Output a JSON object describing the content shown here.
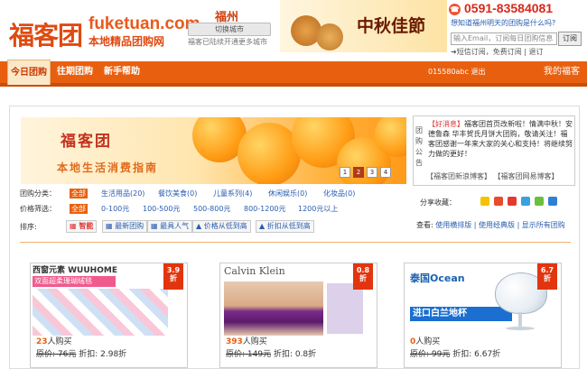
{
  "header": {
    "logo_cn": "福客团",
    "logo_en": "fuketuan.com",
    "logo_tag": "本地精品团购网",
    "city": "福州",
    "switch_city": "切换城市",
    "opened_cities": "福客已陆续开通更多城市",
    "mooncake_banner": "中秋佳節",
    "phone": "0591-83584081",
    "question": "想知道福州明天的团购是什么吗?",
    "email_placeholder": "输入Email，订阅每日团购信息",
    "subscribe": "订阅",
    "subscribe_links": "➜短信订阅，免费订阅 | 退订"
  },
  "nav": {
    "items": [
      "今日团购",
      "往期团购",
      "新手帮助"
    ],
    "user": "015580abc",
    "logout": "退出",
    "mine": "我的福客"
  },
  "slide": {
    "title": "福客团",
    "subtitle": "本地生活消费指南",
    "pages": [
      "1",
      "2",
      "3",
      "4"
    ],
    "current_page": "2"
  },
  "notice": {
    "label": "团购公告",
    "hot": "【好消息】",
    "body": "福客团首页改新啦！情满中秋！安德鲁森 华丰贺氏月饼大团购，敬请关注！福客团感谢一年来大家的关心和支持！将继续努力做的更好！",
    "links": "【福客团新浪博客】 【福客团网易博客】"
  },
  "filters": {
    "category_label": "团购分类：",
    "categories": [
      "全部",
      "生活用品(20)",
      "餐饮美食(0)",
      "儿童系列(4)",
      "休闲娱乐(0)",
      "化妆品(0)"
    ],
    "price_label": "价格筛选：",
    "prices": [
      "全部",
      "0-100元",
      "100-500元",
      "500-800元",
      "800-1200元",
      "1200元以上"
    ],
    "sort_label": "排序:",
    "sorts": [
      "智能",
      "最新团购",
      "最具人气",
      "价格从低到高",
      "折扣从低到高"
    ],
    "share_label": "分享收藏：",
    "view_label": "查看:",
    "view_options": "使用横排版 | 使用经典版 | 显示所有团购"
  },
  "products": [
    {
      "brand": "西窗元素 WUUHOME",
      "promo": "双面超柔珊瑚绒毯",
      "tag": "3.9折",
      "sold": "23",
      "sold_suffix": "人购买",
      "orig": "原价: 76元",
      "discount": "折扣: 2.98折"
    },
    {
      "brand": "Calvin Klein",
      "promo": "Calvin Klein",
      "tag": "0.8折",
      "sold": "393",
      "sold_suffix": "人购买",
      "orig": "原价: 149元",
      "discount": "折扣: 0.8折"
    },
    {
      "brand": "泰国Ocean",
      "promo": "进口白兰地杯",
      "tag": "6.7折",
      "sold": "0",
      "sold_suffix": "人购买",
      "orig": "原价: 99元",
      "discount": "折扣: 6.67折"
    }
  ],
  "colors": {
    "brand_orange": "#e8600f",
    "red": "#d33",
    "link": "#2a5db0"
  }
}
